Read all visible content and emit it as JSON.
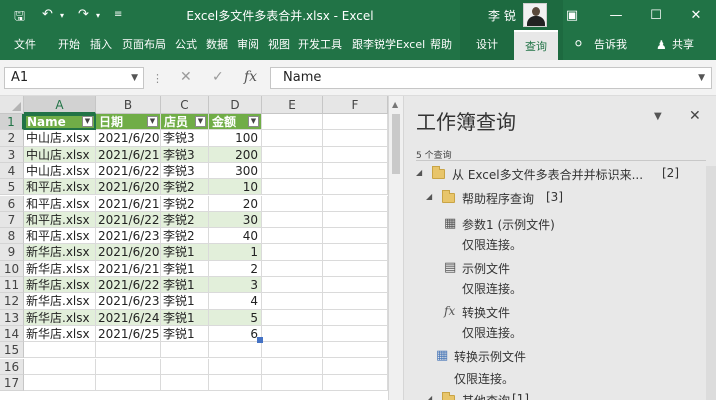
{
  "titlebar": {
    "title": "Excel多文件多表合并.xlsx - Excel",
    "user_name": "李 锐",
    "save_icon": "save-icon",
    "undo_icon": "undo-icon",
    "redo_icon": "redo-icon",
    "customize_icon": "customize-icon"
  },
  "ribbon": {
    "tabs": [
      "文件",
      "开始",
      "插入",
      "页面布局",
      "公式",
      "数据",
      "审阅",
      "视图",
      "开发工具",
      "跟李锐学Excel",
      "帮助"
    ],
    "context_tabs": [
      "设计",
      "查询"
    ],
    "active_context_tab": "查询",
    "tell_me": "告诉我",
    "share": "共享"
  },
  "formula_bar": {
    "name_box": "A1",
    "fx_symbol": "fx",
    "formula": "Name"
  },
  "sheet": {
    "columns": [
      "A",
      "B",
      "C",
      "D",
      "E",
      "F"
    ],
    "rows": [
      "1",
      "2",
      "3",
      "4",
      "5",
      "6",
      "7",
      "8",
      "9",
      "10",
      "11",
      "12",
      "13",
      "14",
      "15",
      "16",
      "17"
    ],
    "headers": [
      "Name",
      "日期",
      "店员",
      "金额"
    ],
    "data": [
      [
        "中山店.xlsx",
        "2021/6/20",
        "李锐3",
        "100"
      ],
      [
        "中山店.xlsx",
        "2021/6/21",
        "李锐3",
        "200"
      ],
      [
        "中山店.xlsx",
        "2021/6/22",
        "李锐3",
        "300"
      ],
      [
        "和平店.xlsx",
        "2021/6/20",
        "李锐2",
        "10"
      ],
      [
        "和平店.xlsx",
        "2021/6/21",
        "李锐2",
        "20"
      ],
      [
        "和平店.xlsx",
        "2021/6/22",
        "李锐2",
        "30"
      ],
      [
        "和平店.xlsx",
        "2021/6/23",
        "李锐2",
        "40"
      ],
      [
        "新华店.xlsx",
        "2021/6/20",
        "李锐1",
        "1"
      ],
      [
        "新华店.xlsx",
        "2021/6/21",
        "李锐1",
        "2"
      ],
      [
        "新华店.xlsx",
        "2021/6/22",
        "李锐1",
        "3"
      ],
      [
        "新华店.xlsx",
        "2021/6/23",
        "李锐1",
        "4"
      ],
      [
        "新华店.xlsx",
        "2021/6/24",
        "李锐1",
        "5"
      ],
      [
        "新华店.xlsx",
        "2021/6/25",
        "李锐1",
        "6"
      ]
    ],
    "colors": {
      "header_bg": "#70ad47",
      "band_bg": "#e2efda",
      "accent": "#217346"
    }
  },
  "queries_pane": {
    "title": "工作簿查询",
    "count": "5 个查询",
    "items": [
      {
        "label": "从 Excel多文件多表合并并标识来...",
        "badge": "[2]"
      },
      {
        "label": "帮助程序查询",
        "badge": "[3]"
      },
      {
        "label": "参数1 (示例文件)",
        "status": "仅限连接。"
      },
      {
        "label": "示例文件",
        "status": "仅限连接。"
      },
      {
        "label": "转换文件",
        "status": "仅限连接。"
      },
      {
        "label": "转换示例文件",
        "status": "仅限连接。"
      },
      {
        "label": "其他查询",
        "badge": "[1]"
      }
    ]
  }
}
